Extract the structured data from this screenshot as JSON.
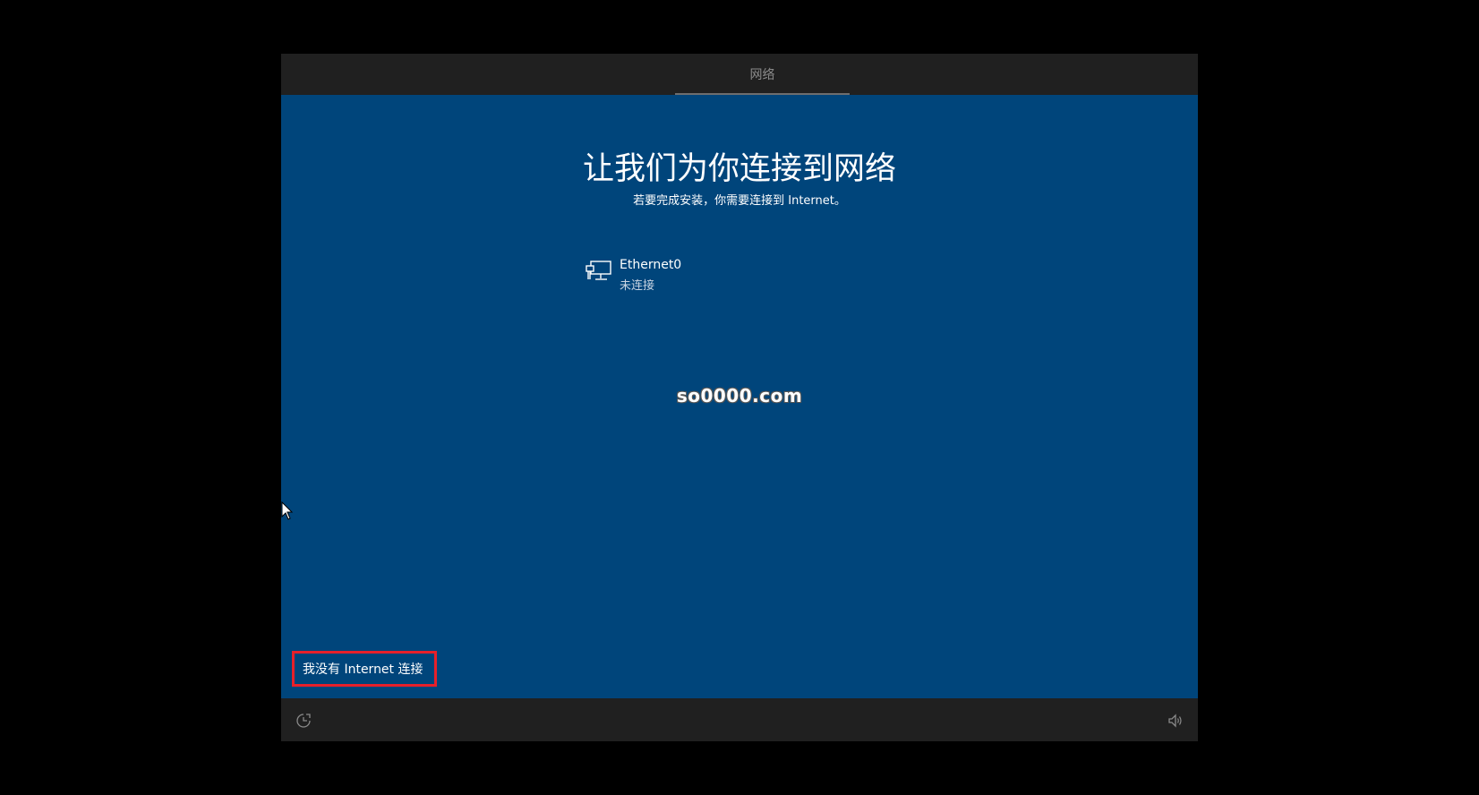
{
  "top_bar": {
    "tab_label": "网络"
  },
  "main": {
    "title": "让我们为你连接到网络",
    "subtitle": "若要完成安装，你需要连接到 Internet。"
  },
  "network": {
    "name": "Ethernet0",
    "status": "未连接",
    "icon": "ethernet-icon"
  },
  "watermark": "so0000.com",
  "footer": {
    "no_internet_link": "我没有 Internet 连接",
    "highlight_color": "#e8202a"
  },
  "bottom_bar": {
    "left_icon": "accessibility-icon",
    "right_icon": "volume-icon"
  },
  "colors": {
    "background": "#00457b",
    "bar": "#202020",
    "screen": "#000000"
  }
}
